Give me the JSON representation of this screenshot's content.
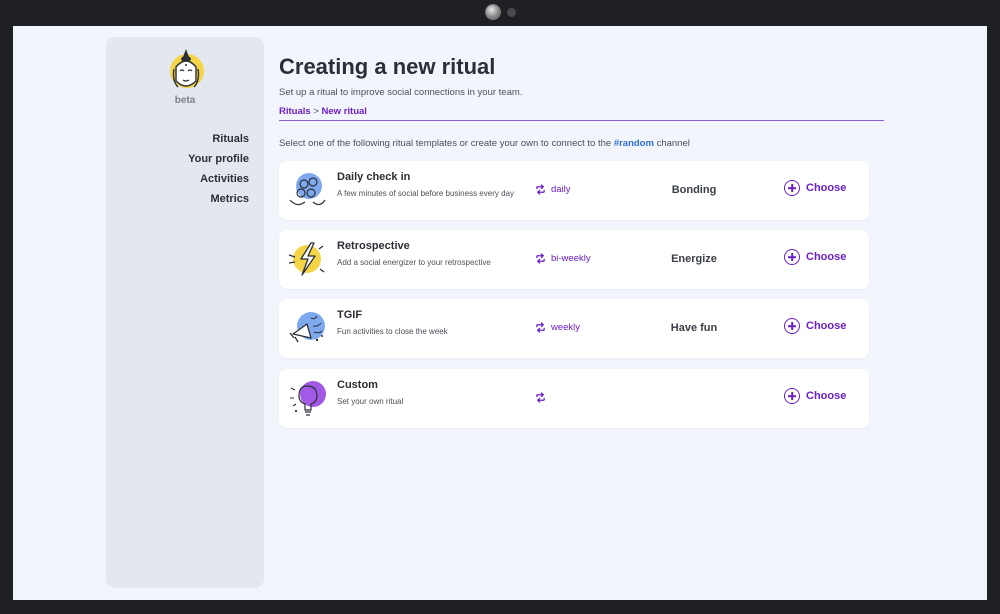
{
  "sidebar": {
    "beta_label": "beta",
    "items": [
      {
        "label": "Rituals"
      },
      {
        "label": "Your profile"
      },
      {
        "label": "Activities"
      },
      {
        "label": "Metrics"
      }
    ]
  },
  "header": {
    "title": "Creating a new ritual",
    "subtitle": "Set up a ritual to improve social connections in your team.",
    "breadcrumb": {
      "root": "Rituals",
      "separator": ">",
      "current": "New ritual"
    }
  },
  "instruction": {
    "before": "Select one of the following ritual templates or create your own to connect to the",
    "channel": "#random",
    "after": "channel"
  },
  "rituals": [
    {
      "name": "Daily check in",
      "description": "A few minutes of social before business every day",
      "frequency": "daily",
      "category": "Bonding",
      "action": "Choose",
      "icon": "faces-group-icon"
    },
    {
      "name": "Retrospective",
      "description": "Add a social energizer to your retrospective",
      "frequency": "bi-weekly",
      "category": "Energize",
      "action": "Choose",
      "icon": "lightning-icon"
    },
    {
      "name": "TGIF",
      "description": "Fun activities to close the week",
      "frequency": "weekly",
      "category": "Have fun",
      "action": "Choose",
      "icon": "megaphone-icon"
    },
    {
      "name": "Custom",
      "description": "Set your own ritual",
      "frequency": "",
      "category": "",
      "action": "Choose",
      "icon": "custom-idea-icon"
    }
  ],
  "colors": {
    "accent": "#6a1fc9",
    "channel": "#2e6fd8",
    "background": "#f2f5fb",
    "sidebar": "#e3e7ee"
  }
}
